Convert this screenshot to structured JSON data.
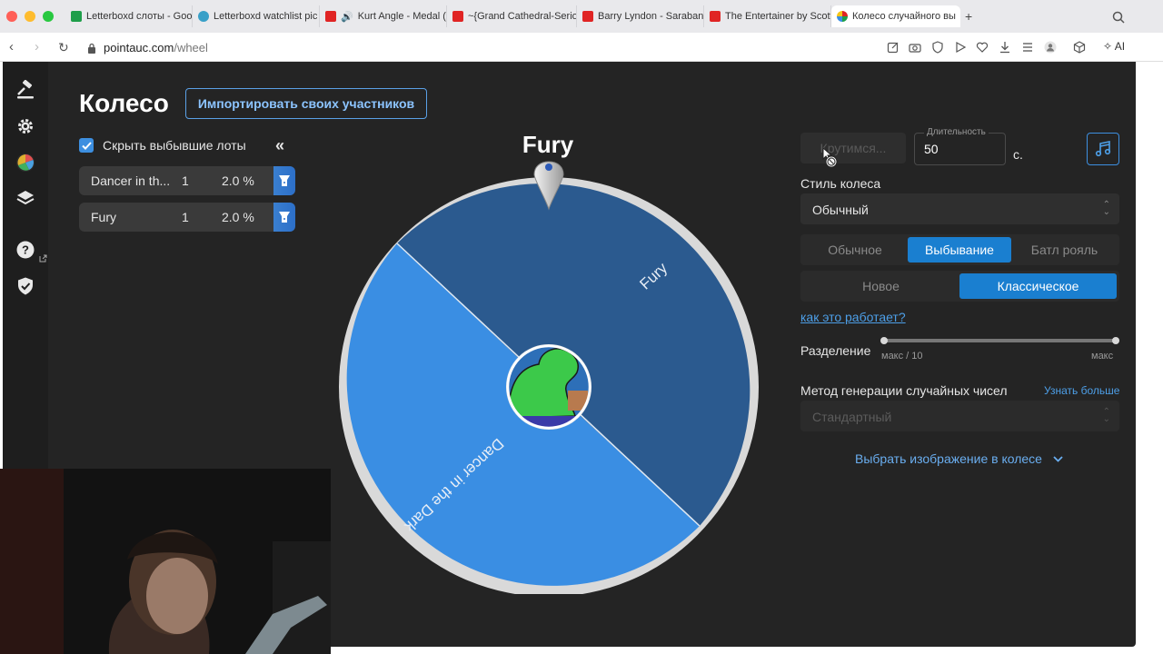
{
  "browser": {
    "tabs": [
      {
        "title": "Letterboxd слоты - Goo",
        "color": "#1e9e4a"
      },
      {
        "title": "Letterboxd watchlist pic",
        "color": "#39a0c8"
      },
      {
        "title": "Kurt Angle - Medal (",
        "color": "#e02424"
      },
      {
        "title": "~{Grand Cathedral-Serio",
        "color": "#e02424"
      },
      {
        "title": "Barry Lyndon - Saraban",
        "color": "#e02424"
      },
      {
        "title": "The Entertainer by Scott",
        "color": "#e02424"
      },
      {
        "title": "Колесо случайного вы",
        "color": "#6c4fd6"
      }
    ],
    "url_host": "pointauc.com",
    "url_path": "/wheel",
    "ai_label": "AI"
  },
  "page": {
    "title": "Колесо",
    "import_button": "Импортировать своих участников",
    "hide_eliminated_label": "Скрыть выбывшие лоты",
    "hide_eliminated_checked": true,
    "collapse_glyph": "«"
  },
  "lots": [
    {
      "name": "Dancer in th...",
      "amount": "1",
      "percent": "2.0 %"
    },
    {
      "name": "Fury",
      "amount": "1",
      "percent": "2.0 %"
    }
  ],
  "wheel": {
    "winner": "Fury",
    "segments": [
      {
        "label": "Fury",
        "color": "#2b5a8f"
      },
      {
        "label": "Dancer in the Dark",
        "color": "#3a8ee3"
      }
    ]
  },
  "controls": {
    "spin_button": "Крутимся...",
    "duration_label": "Длительность",
    "duration_value": "50",
    "duration_unit": "с.",
    "wheel_style_label": "Стиль колеса",
    "wheel_style_value": "Обычный",
    "mode_options": [
      "Обычное",
      "Выбывание",
      "Батл рояль"
    ],
    "mode_selected": "Выбывание",
    "variant_options": [
      "Новое",
      "Классическое"
    ],
    "variant_selected": "Классическое",
    "how_it_works": "как это работает?",
    "split_label": "Разделение",
    "split_min_label": "макс / 10",
    "split_max_label": "макс",
    "rng_label": "Метод генерации случайных чисел",
    "rng_learn_more": "Узнать больше",
    "rng_value": "Стандартный",
    "choose_image": "Выбрать изображение в колесе"
  },
  "colors": {
    "accent": "#1a7fd0",
    "background": "#242424"
  }
}
